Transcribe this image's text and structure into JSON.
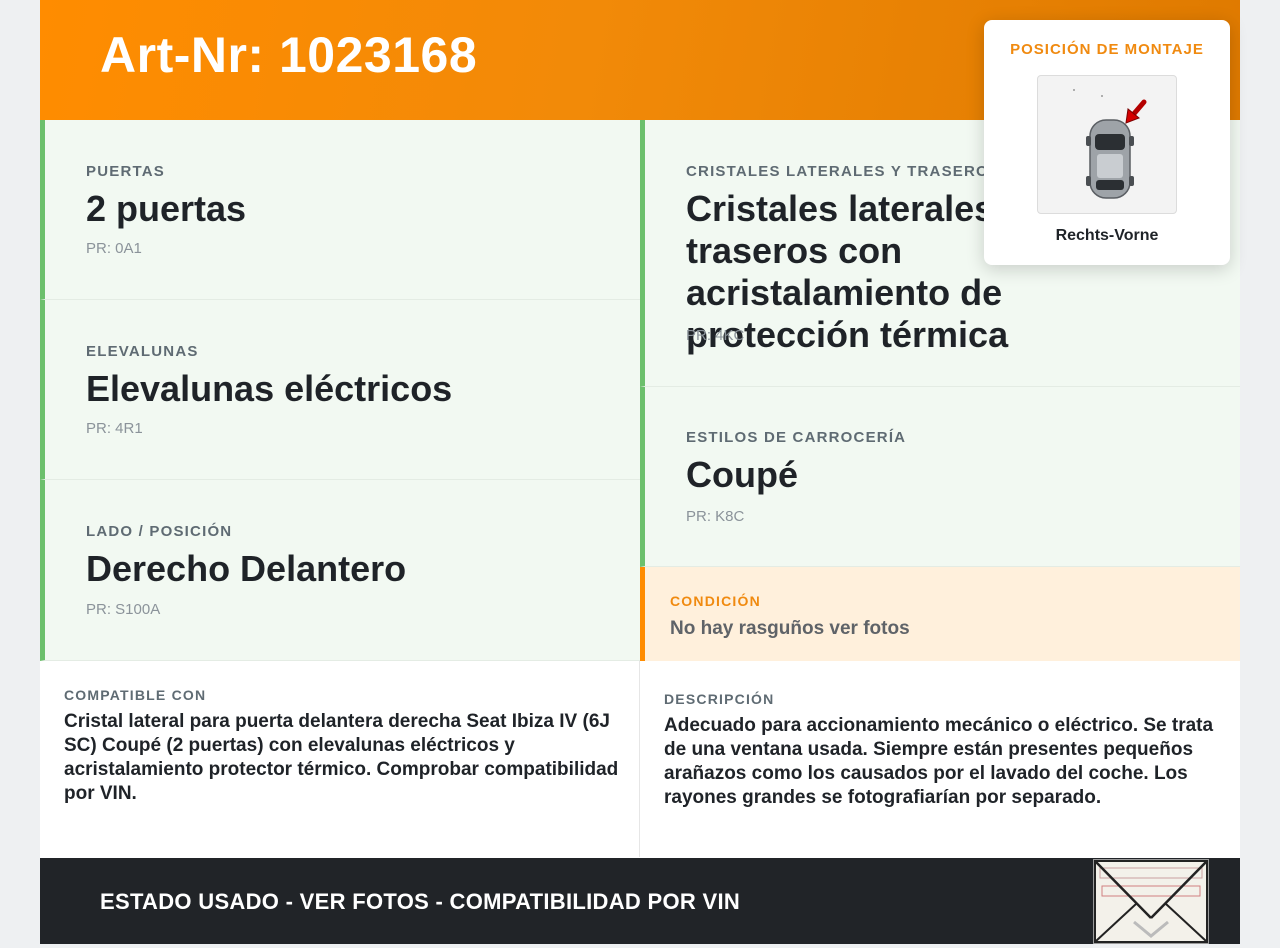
{
  "header": {
    "title": "Art-Nr: 1023168"
  },
  "specs_left": [
    {
      "label": "PUERTAS",
      "value": "2 puertas",
      "pr": "PR: 0A1"
    },
    {
      "label": "ELEVALUNAS",
      "value": "Elevalunas eléctricos",
      "pr": "PR: 4R1"
    },
    {
      "label": "LADO / POSICIÓN",
      "value": "Derecho Delantero",
      "pr": "PR: S100A"
    }
  ],
  "specs_right": [
    {
      "label": "CRISTALES LATERALES Y TRASEROS",
      "value": "Cristales laterales y traseros con acristalamiento de protección térmica",
      "pr": "PR: 4KC"
    },
    {
      "label": "ESTILOS DE CARROCERÍA",
      "value": "Coupé",
      "pr": "PR: K8C"
    }
  ],
  "condition": {
    "label": "CONDICIÓN",
    "text": "No hay rasguños ver fotos"
  },
  "compatible": {
    "label": "COMPATIBLE CON",
    "text": "Cristal lateral para puerta delantera derecha Seat Ibiza IV (6J SC) Coupé (2 puertas) con elevalunas eléctricos y acristalamiento protector térmico. Comprobar compatibilidad por VIN."
  },
  "description": {
    "label": "DESCRIPCIÓN",
    "text": "Adecuado para accionamiento mecánico o eléctrico. Se trata de una ventana usada. Siempre están presentes pequeños arañazos como los causados por el lavado del coche. Los rayones grandes se fotografiarían por separado."
  },
  "footer": {
    "text": "ESTADO USADO - VER FOTOS - COMPATIBILIDAD POR VIN"
  },
  "mounting": {
    "title": "POSICIÓN DE MONTAJE",
    "position": "Rechts-Vorne",
    "image_icon": "car-top-view-icon",
    "arrow_icon": "red-arrow-icon"
  },
  "colors": {
    "accent": "#ff8c00",
    "spec_bg": "#f2f9f2",
    "spec_border": "#6cc06c",
    "condition_bg": "#fff0dc",
    "footer_bg": "#212428"
  }
}
